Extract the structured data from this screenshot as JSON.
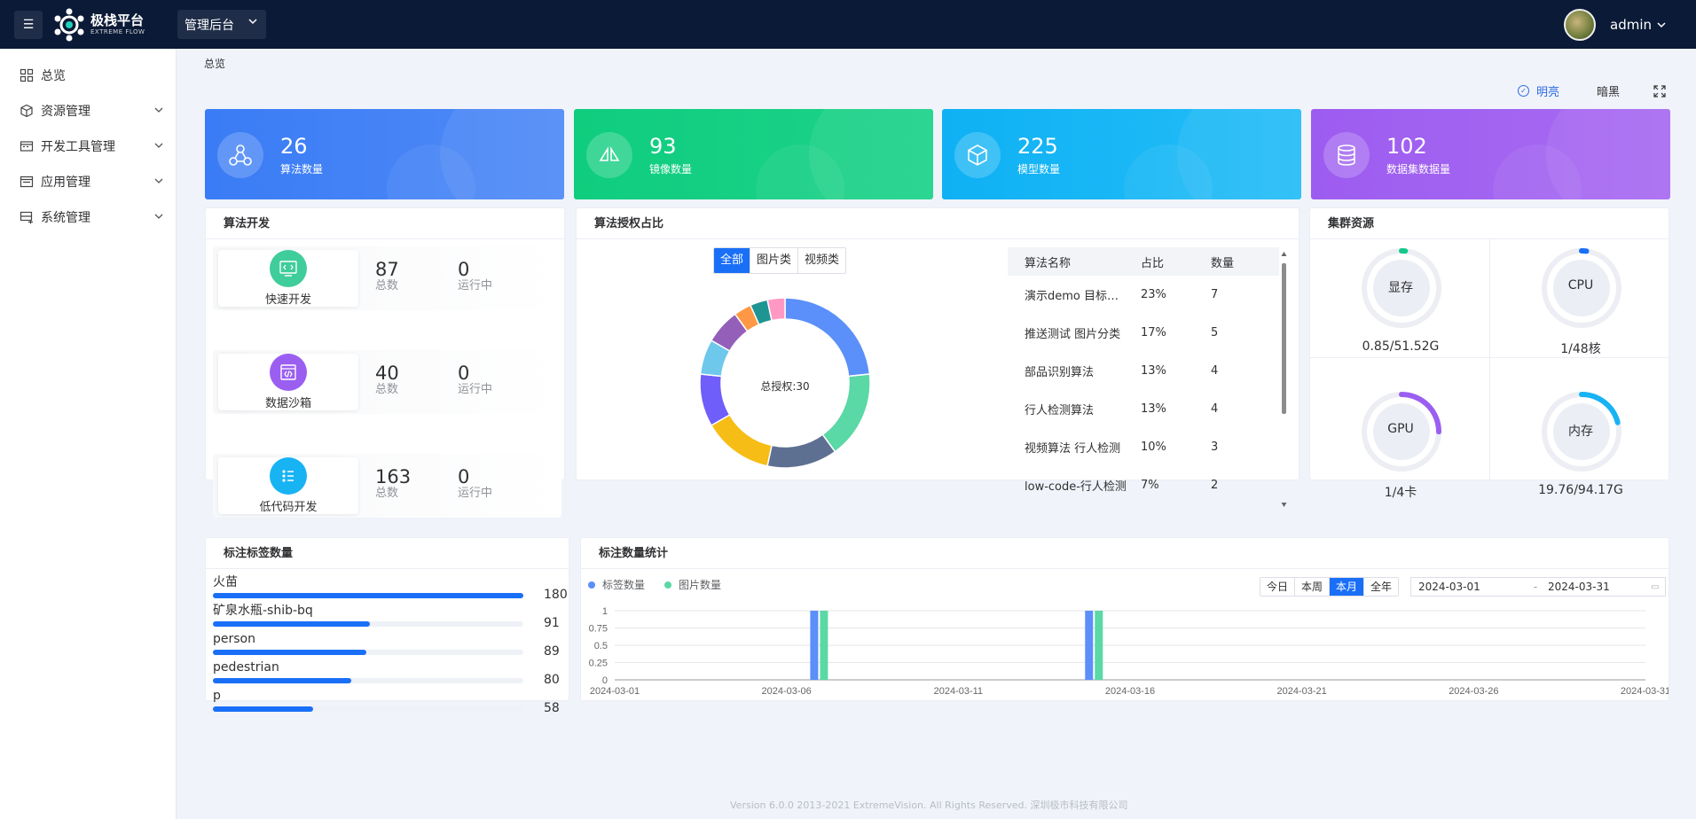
{
  "header": {
    "logo_cn": "极栈平台",
    "logo_en": "EXTREME FLOW",
    "system_selector": "管理后台",
    "username": "admin"
  },
  "sidebar": {
    "items": [
      {
        "label": "总览",
        "icon": "dashboard-icon"
      },
      {
        "label": "资源管理",
        "icon": "cube-icon"
      },
      {
        "label": "开发工具管理",
        "icon": "toolbox-icon"
      },
      {
        "label": "应用管理",
        "icon": "app-window-icon"
      },
      {
        "label": "系统管理",
        "icon": "server-icon"
      }
    ]
  },
  "breadcrumb": "总览",
  "themes": {
    "light": "明亮",
    "dark": "暗黑"
  },
  "stats": [
    {
      "value": "26",
      "label": "算法数量",
      "color": "#3a7cf5"
    },
    {
      "value": "93",
      "label": "镜像数量",
      "color": "#13cf80"
    },
    {
      "value": "225",
      "label": "模型数量",
      "color": "#12b3f4"
    },
    {
      "value": "102",
      "label": "数据集数据量",
      "color": "#a461f0"
    }
  ],
  "algodev": {
    "title": "算法开发",
    "rows": [
      {
        "name": "快速开发",
        "total": "87",
        "total_label": "总数",
        "running": "0",
        "running_label": "运行中",
        "color": "#3fcd9c"
      },
      {
        "name": "数据沙箱",
        "total": "40",
        "total_label": "总数",
        "running": "0",
        "running_label": "运行中",
        "color": "#9a5ff1"
      },
      {
        "name": "低代码开发",
        "total": "163",
        "total_label": "总数",
        "running": "0",
        "running_label": "运行中",
        "color": "#18b3f3"
      }
    ]
  },
  "license": {
    "title": "算法授权占比",
    "tabs": [
      "全部",
      "图片类",
      "视频类"
    ],
    "active_tab": 0,
    "center_label": "总授权:30",
    "columns": [
      "算法名称",
      "占比",
      "数量"
    ],
    "rows": [
      {
        "name": "演示demo 目标检测",
        "pct": "23%",
        "count": "7"
      },
      {
        "name": "推送测试 图片分类",
        "pct": "17%",
        "count": "5"
      },
      {
        "name": "部品识别算法",
        "pct": "13%",
        "count": "4"
      },
      {
        "name": "行人检测算法",
        "pct": "13%",
        "count": "4"
      },
      {
        "name": "视频算法 行人检测",
        "pct": "10%",
        "count": "3"
      },
      {
        "name": "low-code-行人检测",
        "pct": "7%",
        "count": "2"
      }
    ],
    "donut": [
      {
        "value": 7,
        "color": "#5b8ff9"
      },
      {
        "value": 5,
        "color": "#5ad8a6"
      },
      {
        "value": 4,
        "color": "#5d7092"
      },
      {
        "value": 4,
        "color": "#f6bd16"
      },
      {
        "value": 3,
        "color": "#6f5ef9"
      },
      {
        "value": 2,
        "color": "#6dc8ec"
      },
      {
        "value": 2,
        "color": "#945fb9"
      },
      {
        "value": 1,
        "color": "#ff9845"
      },
      {
        "value": 1,
        "color": "#1e9493"
      },
      {
        "value": 1,
        "color": "#ff99c3"
      }
    ]
  },
  "cluster": {
    "title": "集群资源",
    "items": [
      {
        "name": "显存",
        "value": "0.85/51.52G",
        "ratio": 0.0165,
        "color": "#13c98a"
      },
      {
        "name": "CPU",
        "value": "1/48核",
        "ratio": 0.021,
        "color": "#1a6ff7"
      },
      {
        "name": "GPU",
        "value": "1/4卡",
        "ratio": 0.25,
        "color": "#9a5ff1"
      },
      {
        "name": "内存",
        "value": "19.76/94.17G",
        "ratio": 0.21,
        "color": "#18b3f3"
      }
    ]
  },
  "tags": {
    "title": "标注标签数量",
    "items": [
      {
        "name": "火苗",
        "value": 180
      },
      {
        "name": "矿泉水瓶-shib-bq",
        "value": 91
      },
      {
        "name": "person",
        "value": 89
      },
      {
        "name": "pedestrian",
        "value": 80
      },
      {
        "name": "p",
        "value": 58
      }
    ]
  },
  "annot": {
    "title": "标注数量统计",
    "tabs": [
      "今日",
      "本周",
      "本月",
      "全年"
    ],
    "active_tab": 2,
    "start": "2024-03-01",
    "sep": "-",
    "end": "2024-03-31"
  },
  "chart_data": {
    "type": "bar",
    "x": [
      "2024-03-01",
      "2024-03-02",
      "2024-03-03",
      "2024-03-04",
      "2024-03-05",
      "2024-03-06",
      "2024-03-07",
      "2024-03-08",
      "2024-03-09",
      "2024-03-10",
      "2024-03-11",
      "2024-03-12",
      "2024-03-13",
      "2024-03-14",
      "2024-03-15",
      "2024-03-16",
      "2024-03-17",
      "2024-03-18",
      "2024-03-19",
      "2024-03-20",
      "2024-03-21",
      "2024-03-22",
      "2024-03-23",
      "2024-03-24",
      "2024-03-25",
      "2024-03-26",
      "2024-03-27",
      "2024-03-28",
      "2024-03-29",
      "2024-03-30",
      "2024-03-31"
    ],
    "series": [
      {
        "name": "标签数量",
        "color": "#5b8ff9",
        "values": [
          0,
          0,
          0,
          0,
          0,
          0,
          1,
          0,
          0,
          0,
          0,
          0,
          0,
          0,
          1,
          0,
          0,
          0,
          0,
          0,
          0,
          0,
          0,
          0,
          0,
          0,
          0,
          0,
          0,
          0,
          0
        ]
      },
      {
        "name": "图片数量",
        "color": "#5ad8a6",
        "values": [
          0,
          0,
          0,
          0,
          0,
          0,
          1,
          0,
          0,
          0,
          0,
          0,
          0,
          0,
          1,
          0,
          0,
          0,
          0,
          0,
          0,
          0,
          0,
          0,
          0,
          0,
          0,
          0,
          0,
          0,
          0
        ]
      }
    ],
    "ylim": [
      0,
      1
    ],
    "yticks": [
      "0",
      "0.25",
      "0.5",
      "0.75",
      "1"
    ],
    "xticks": [
      "2024-03-01",
      "2024-03-06",
      "2024-03-11",
      "2024-03-16",
      "2024-03-21",
      "2024-03-26",
      "2024-03-31"
    ]
  },
  "footer": "Version 6.0.0 2013-2021 ExtremeVision. All Rights Reserved. 深圳极市科技有限公司"
}
